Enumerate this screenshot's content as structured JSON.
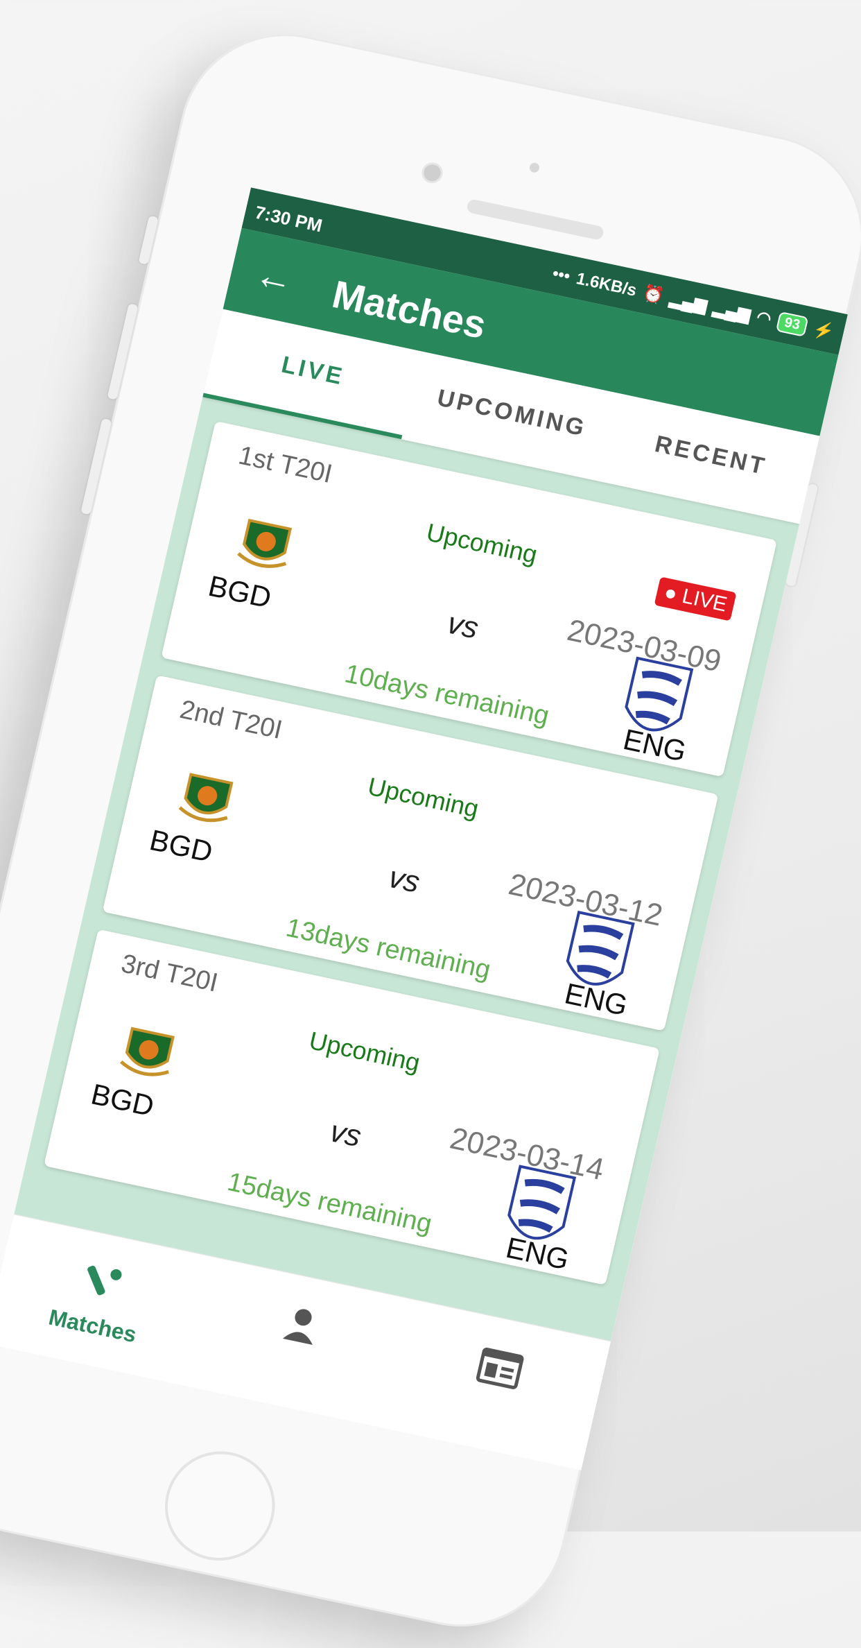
{
  "status_bar": {
    "time": "7:30 PM",
    "speed": "1.6KB/s",
    "battery": "93"
  },
  "app_bar": {
    "title": "Matches"
  },
  "tabs": [
    {
      "label": "LIVE",
      "active": true
    },
    {
      "label": "UPCOMING",
      "active": false
    },
    {
      "label": "RECENT",
      "active": false
    }
  ],
  "matches": [
    {
      "name": "1st T20I",
      "status": "Upcoming",
      "live_badge": "LIVE",
      "date": "2023-03-09",
      "team1": "BGD",
      "vs": "vs",
      "team2": "ENG",
      "remaining": "10days remaining"
    },
    {
      "name": "2nd T20I",
      "status": "Upcoming",
      "date": "2023-03-12",
      "team1": "BGD",
      "vs": "vs",
      "team2": "ENG",
      "remaining": "13days remaining"
    },
    {
      "name": "3rd T20I",
      "status": "Upcoming",
      "date": "2023-03-14",
      "team1": "BGD",
      "vs": "vs",
      "team2": "ENG",
      "remaining": "15days remaining"
    }
  ],
  "bottom_nav": [
    {
      "label": "Matches",
      "icon": "cricket-icon",
      "active": true
    },
    {
      "label": "",
      "icon": "person-icon",
      "active": false
    },
    {
      "label": "",
      "icon": "news-icon",
      "active": false
    }
  ],
  "colors": {
    "primary": "#28885b",
    "status_bar": "#1e6044",
    "list_bg": "#c8e6d6",
    "live_badge": "#e31c23"
  }
}
